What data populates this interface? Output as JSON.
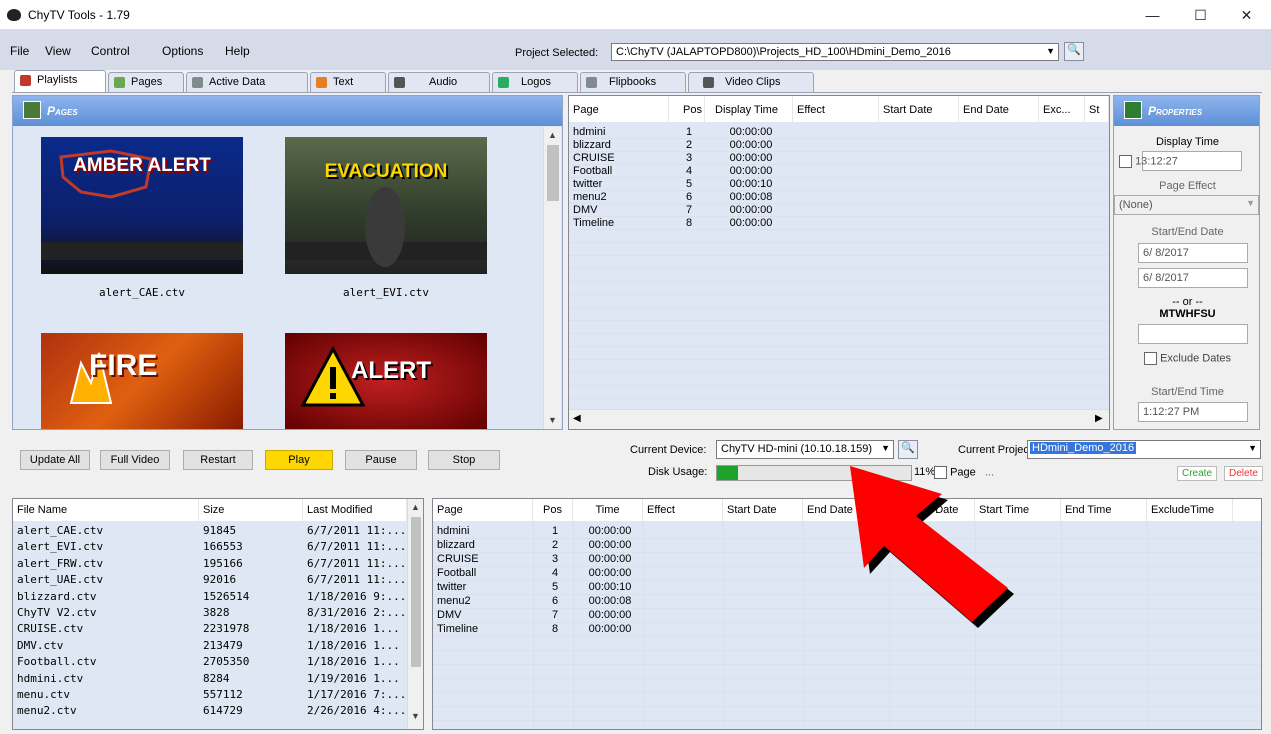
{
  "window": {
    "title": "ChyTV Tools - 1.79",
    "minimize": "—",
    "maximize": "☐",
    "close": "✕"
  },
  "menu": [
    "File",
    "View",
    "Control",
    "Options",
    "Help"
  ],
  "project": {
    "label": "Project Selected:",
    "value": "C:\\ChyTV (JALAPTOPD800)\\Projects_HD_100\\HDmini_Demo_2016"
  },
  "tabs": [
    {
      "label": "Playlists",
      "icon_color": "#c0392b"
    },
    {
      "label": "Pages",
      "icon_color": "#6aa84f"
    },
    {
      "label": "Active Data",
      "icon_color": "#7f8c8d"
    },
    {
      "label": "Text",
      "icon_color": "#e67e22"
    },
    {
      "label": "Audio",
      "icon_color": "#555555"
    },
    {
      "label": "Logos",
      "icon_color": "#27ae60"
    },
    {
      "label": "Flipbooks",
      "icon_color": "#7f8c8d"
    },
    {
      "label": "Video Clips",
      "icon_color": "#555555"
    }
  ],
  "pages_panel": {
    "title": "Pages",
    "thumbs": [
      {
        "caption": "alert_CAE.ctv",
        "banner": "AMBER ALERT"
      },
      {
        "caption": "alert_EVI.ctv",
        "banner": "EVACUATION"
      },
      {
        "caption": "",
        "banner": "FIRE"
      },
      {
        "caption": "",
        "banner": "ALERT"
      }
    ]
  },
  "playlist_grid": {
    "headers": [
      "Page",
      "Pos",
      "Display Time",
      "Effect",
      "Start Date",
      "End Date",
      "Exc...",
      "St"
    ],
    "rows": [
      [
        "hdmini",
        "1",
        "00:00:00"
      ],
      [
        "blizzard",
        "2",
        "00:00:00"
      ],
      [
        "CRUISE",
        "3",
        "00:00:00"
      ],
      [
        "Football",
        "4",
        "00:00:00"
      ],
      [
        "twitter",
        "5",
        "00:00:10"
      ],
      [
        "menu2",
        "6",
        "00:00:08"
      ],
      [
        "DMV",
        "7",
        "00:00:00"
      ],
      [
        "Timeline",
        "8",
        "00:00:00"
      ]
    ]
  },
  "properties": {
    "title": "Properties",
    "display_time_label": "Display Time",
    "display_time": "13:12:27",
    "page_effect_label": "Page Effect",
    "page_effect": "(None)",
    "start_end_date_label": "Start/End Date",
    "start_date": "6/ 8/2017",
    "end_date": "6/ 8/2017",
    "or": "-- or --",
    "days": "MTWHFSU",
    "exclude_dates": "Exclude Dates",
    "start_end_time_label": "Start/End Time",
    "start_time": "1:12:27 PM"
  },
  "controls": {
    "update_all": "Update All",
    "full_video": "Full Video",
    "restart": "Restart",
    "play": "Play",
    "pause": "Pause",
    "stop": "Stop"
  },
  "device": {
    "label": "Current Device:",
    "value": "ChyTV HD-mini (10.10.18.159)",
    "disk_label": "Disk Usage:",
    "disk_pct": "11%",
    "disk_fraction": 0.11,
    "page_label": "Page",
    "page_value": "...",
    "project_label": "Current Project:",
    "project_value": "HDmini_Demo_2016",
    "create": "Create",
    "delete": "Delete"
  },
  "files_grid": {
    "headers": [
      "File Name",
      "Size",
      "Last Modified"
    ],
    "rows": [
      [
        "alert_CAE.ctv",
        "91845",
        "6/7/2011 11:..."
      ],
      [
        "alert_EVI.ctv",
        "166553",
        "6/7/2011 11:..."
      ],
      [
        "alert_FRW.ctv",
        "195166",
        "6/7/2011 11:..."
      ],
      [
        "alert_UAE.ctv",
        "92016",
        "6/7/2011 11:..."
      ],
      [
        "blizzard.ctv",
        "1526514",
        "1/18/2016 9:..."
      ],
      [
        "ChyTV V2.ctv",
        "3828",
        "8/31/2016 2:..."
      ],
      [
        "CRUISE.ctv",
        "2231978",
        "1/18/2016 1..."
      ],
      [
        "DMV.ctv",
        "213479",
        "1/18/2016 1..."
      ],
      [
        "Football.ctv",
        "2705350",
        "1/18/2016 1..."
      ],
      [
        "hdmini.ctv",
        "8284",
        "1/19/2016 1..."
      ],
      [
        "menu.ctv",
        "557112",
        "1/17/2016 7:..."
      ],
      [
        "menu2.ctv",
        "614729",
        "2/26/2016 4:..."
      ]
    ]
  },
  "device_grid": {
    "headers": [
      "Page",
      "Pos",
      "Time",
      "Effect",
      "Start Date",
      "End Date",
      "Exclude Date",
      "Start Time",
      "End Time",
      "ExcludeTime"
    ],
    "rows": [
      [
        "hdmini",
        "1",
        "00:00:00"
      ],
      [
        "blizzard",
        "2",
        "00:00:00"
      ],
      [
        "CRUISE",
        "3",
        "00:00:00"
      ],
      [
        "Football",
        "4",
        "00:00:00"
      ],
      [
        "twitter",
        "5",
        "00:00:10"
      ],
      [
        "menu2",
        "6",
        "00:00:08"
      ],
      [
        "DMV",
        "7",
        "00:00:00"
      ],
      [
        "Timeline",
        "8",
        "00:00:00"
      ]
    ]
  },
  "colors": {
    "accent": "#5d8fd6",
    "arrow": "#ff0000",
    "play": "#ffd700"
  }
}
